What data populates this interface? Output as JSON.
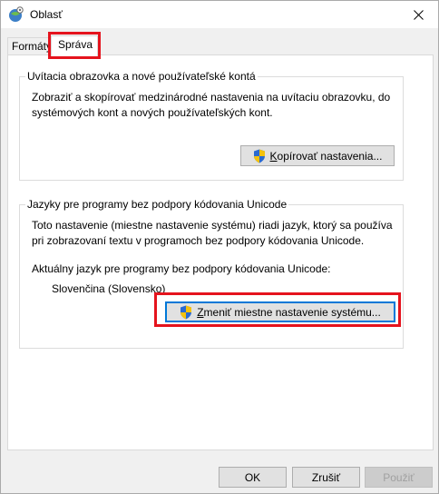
{
  "window": {
    "title": "Oblasť",
    "title_icon": "globe-region-icon",
    "close_icon": "close-icon"
  },
  "tabs": [
    {
      "label": "Formáty",
      "active": false
    },
    {
      "label": "Správa",
      "active": true
    }
  ],
  "welcome_group": {
    "legend": "Uvítacia obrazovka a nové používateľské kontá",
    "description": "Zobraziť a skopírovať medzinárodné nastavenia na uvítaciu obrazovku, do systémových kont a nových používateľských kont.",
    "button_label_underlined": "K",
    "button_label_rest": "opírovať nastavenia...",
    "button_icon": "uac-shield-icon"
  },
  "unicode_group": {
    "legend": "Jazyky pre programy bez podpory kódovania Unicode",
    "description": "Toto nastavenie (miestne nastavenie systému) riadi jazyk, ktorý sa používa pri zobrazovaní textu v programoch bez podpory kódovania Unicode.",
    "current_label": "Aktuálny jazyk pre programy bez podpory kódovania Unicode:",
    "current_value": "Slovenčina (Slovensko)",
    "button_label_underlined": "Z",
    "button_label_rest": "meniť miestne nastavenie systému...",
    "button_icon": "uac-shield-icon"
  },
  "footer": {
    "ok_label": "OK",
    "cancel_label": "Zrušiť",
    "apply_label": "Použiť"
  },
  "colors": {
    "highlight": "#e5131d",
    "focus": "#0078d7"
  }
}
